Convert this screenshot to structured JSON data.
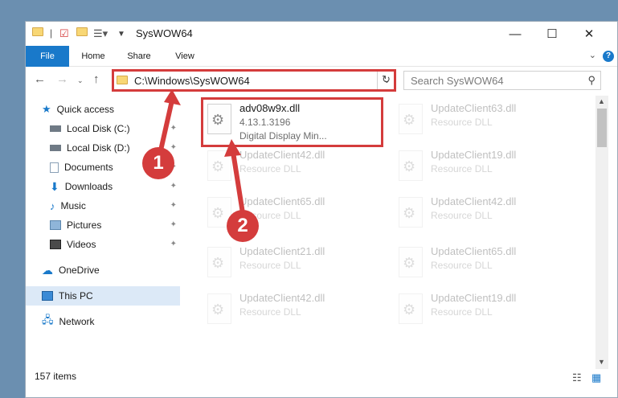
{
  "window": {
    "title": "SysWOW64",
    "controls": {
      "minimize": "—",
      "maximize": "☐",
      "close": "✕"
    }
  },
  "ribbon": {
    "tabs": [
      "File",
      "Home",
      "Share",
      "View"
    ],
    "help": "?"
  },
  "address_bar": {
    "path": "C:\\Windows\\SysWOW64"
  },
  "search": {
    "placeholder": "Search SysWOW64"
  },
  "navigation": {
    "items": [
      {
        "label": "Quick access",
        "icon": "star-icon"
      },
      {
        "label": "Local Disk (C:)",
        "icon": "drive-icon"
      },
      {
        "label": "Local Disk (D:)",
        "icon": "drive-icon"
      },
      {
        "label": "Documents",
        "icon": "documents-icon"
      },
      {
        "label": "Downloads",
        "icon": "download-icon"
      },
      {
        "label": "Music",
        "icon": "music-icon"
      },
      {
        "label": "Pictures",
        "icon": "pictures-icon"
      },
      {
        "label": "Videos",
        "icon": "videos-icon"
      },
      {
        "label": "OneDrive",
        "icon": "cloud-icon"
      },
      {
        "label": "This PC",
        "icon": "computer-icon"
      },
      {
        "label": "Network",
        "icon": "network-icon"
      }
    ]
  },
  "files": [
    {
      "name": "adv08w9x.dll",
      "version": "4.13.1.3196",
      "description": "Digital Display Min..."
    },
    {
      "name": "UpdateClient63.dll",
      "type": "Resource DLL"
    },
    {
      "name": "UpdateClient42.dll",
      "type": "Resource DLL"
    },
    {
      "name": "UpdateClient19.dll",
      "type": "Resource DLL"
    },
    {
      "name": "UpdateClient65.dll",
      "type": "Resource DLL"
    },
    {
      "name": "UpdateClient42.dll",
      "type": "Resource DLL"
    },
    {
      "name": "UpdateClient21.dll",
      "type": "Resource DLL"
    },
    {
      "name": "UpdateClient65.dll",
      "type": "Resource DLL"
    },
    {
      "name": "UpdateClient42.dll",
      "type": "Resource DLL"
    },
    {
      "name": "UpdateClient19.dll",
      "type": "Resource DLL"
    }
  ],
  "status": {
    "item_count": "157 items"
  },
  "annotations": {
    "step1": "1",
    "step2": "2"
  },
  "colors": {
    "accent": "#1979ca",
    "highlight": "#d43c3c",
    "selection": "#dce9f7"
  }
}
